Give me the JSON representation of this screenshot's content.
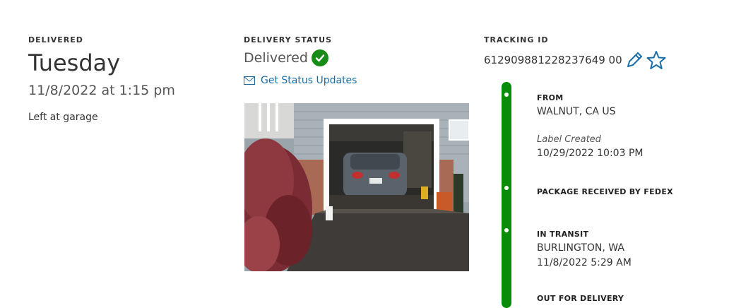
{
  "delivered": {
    "label": "DELIVERED",
    "day": "Tuesday",
    "datetime": "11/8/2022 at 1:15 pm",
    "note": "Left at garage"
  },
  "delivery_status": {
    "label": "DELIVERY STATUS",
    "status": "Delivered",
    "updates_link": "Get Status Updates",
    "status_color": "#188c18"
  },
  "tracking": {
    "label": "TRACKING ID",
    "id": "612909881228237649 00"
  },
  "timeline": {
    "color": "#0a8b0a",
    "events": [
      {
        "heading": "FROM",
        "location": "WALNUT, CA US",
        "sub_label": "Label Created",
        "time": "10/29/2022 10:03 PM"
      },
      {
        "heading": "PACKAGE RECEIVED BY FEDEX"
      },
      {
        "heading": "IN TRANSIT",
        "location": "BURLINGTON, WA",
        "time": "11/8/2022 5:29 AM"
      },
      {
        "heading": "OUT FOR DELIVERY"
      }
    ]
  },
  "accent_color": "#1a6ea8"
}
